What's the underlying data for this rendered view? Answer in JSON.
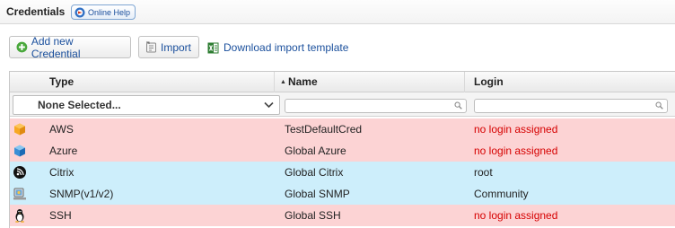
{
  "header": {
    "title": "Credentials",
    "help_label": "Online Help"
  },
  "toolbar": {
    "add_label": "Add new Credential",
    "import_label": "Import",
    "download_label": "Download import template"
  },
  "grid": {
    "columns": {
      "type": "Type",
      "name": "Name",
      "login": "Login"
    },
    "sorted_column": "Name",
    "filters": {
      "type_selected": "None Selected...",
      "name_value": "",
      "login_value": ""
    },
    "rows": [
      {
        "icon": "aws-icon",
        "type": "AWS",
        "name": "TestDefaultCred",
        "login": "no login assigned",
        "status": "none"
      },
      {
        "icon": "azure-icon",
        "type": "Azure",
        "name": "Global Azure",
        "login": "no login assigned",
        "status": "none"
      },
      {
        "icon": "citrix-icon",
        "type": "Citrix",
        "name": "Global Citrix",
        "login": "root",
        "status": "assigned"
      },
      {
        "icon": "snmp-icon",
        "type": "SNMP(v1/v2)",
        "name": "Global SNMP",
        "login": "Community",
        "status": "assigned"
      },
      {
        "icon": "ssh-linux-icon",
        "type": "SSH",
        "name": "Global SSH",
        "login": "no login assigned",
        "status": "none"
      }
    ]
  },
  "colors": {
    "unassigned_row": "#fcd3d4",
    "assigned_row": "#cdeefb",
    "unassigned_text": "#d60000",
    "link": "#1a4f9c"
  }
}
